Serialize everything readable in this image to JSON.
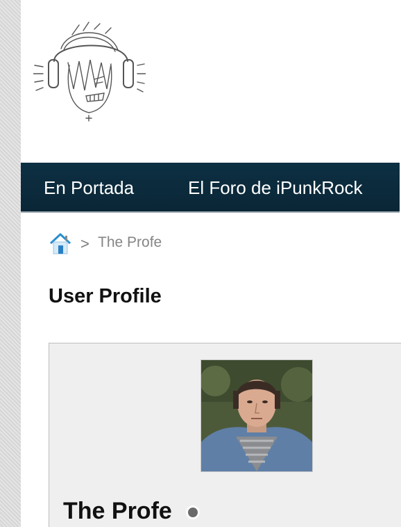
{
  "nav": {
    "items": [
      {
        "label": "En Portada"
      },
      {
        "label": "El Foro de iPunkRock"
      }
    ]
  },
  "breadcrumb": {
    "home_icon": "home-icon",
    "separator": ">",
    "current": "The Profe"
  },
  "page": {
    "title": "User Profile"
  },
  "profile": {
    "username": "The Profe",
    "status": "offline",
    "status_color": "#6b6b6b"
  },
  "colors": {
    "navbar": "#0d3043",
    "card_bg": "#efefef"
  }
}
